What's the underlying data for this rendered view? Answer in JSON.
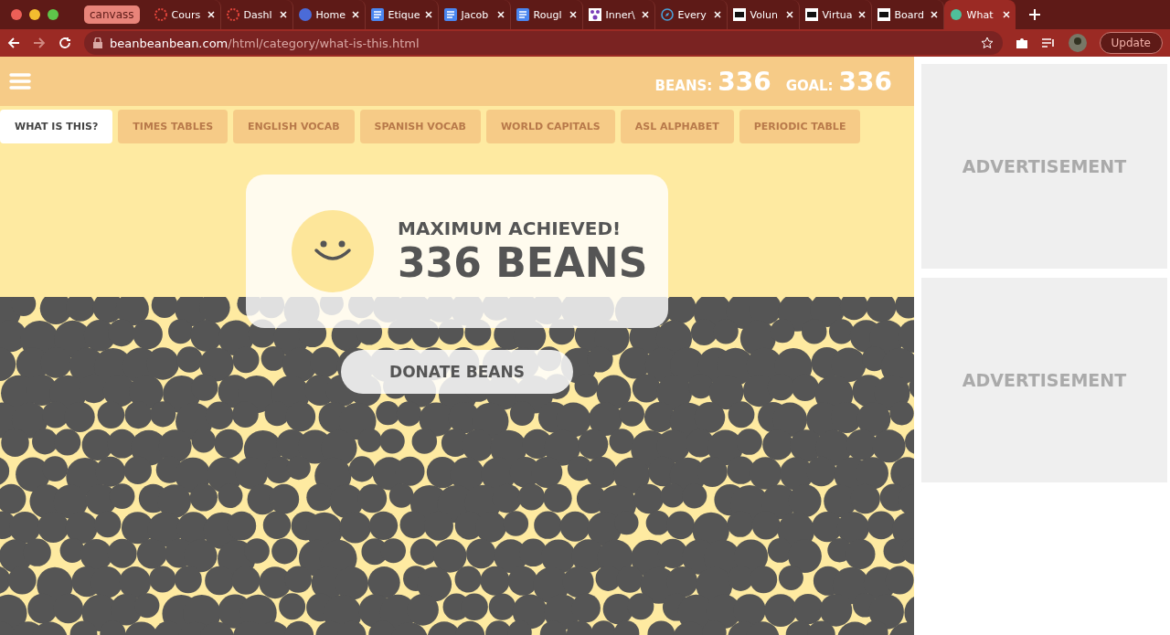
{
  "browser": {
    "tab_group": "canvass",
    "tabs": [
      {
        "title": "Cours",
        "kind": "wheel",
        "selected": false
      },
      {
        "title": "Dashl",
        "kind": "wheel",
        "selected": false
      },
      {
        "title": "Home",
        "kind": "circle",
        "selected": false
      },
      {
        "title": "Etique",
        "kind": "doc",
        "selected": false
      },
      {
        "title": "Jacob",
        "kind": "doc",
        "selected": false
      },
      {
        "title": "Rougl",
        "kind": "doc",
        "selected": false
      },
      {
        "title": "Inner\\",
        "kind": "network",
        "selected": false
      },
      {
        "title": "Every",
        "kind": "compass",
        "selected": false
      },
      {
        "title": "Volun",
        "kind": "square",
        "selected": false
      },
      {
        "title": "Virtua",
        "kind": "square",
        "selected": false
      },
      {
        "title": "Board",
        "kind": "square",
        "selected": false
      },
      {
        "title": "What",
        "kind": "dot",
        "selected": true
      }
    ],
    "url_host": "beanbeanbean.com",
    "url_path": "/html/category/what-is-this.html",
    "update": "Update"
  },
  "header": {
    "beans_label": "BEANS:",
    "beans": "336",
    "goal_label": "GOAL:",
    "goal": "336"
  },
  "categories": [
    {
      "label": "WHAT IS THIS?",
      "selected": true
    },
    {
      "label": "TIMES TABLES",
      "selected": false
    },
    {
      "label": "ENGLISH VOCAB",
      "selected": false
    },
    {
      "label": "SPANISH VOCAB",
      "selected": false
    },
    {
      "label": "WORLD CAPITALS",
      "selected": false
    },
    {
      "label": "ASL ALPHABET",
      "selected": false
    },
    {
      "label": "PERIODIC TABLE",
      "selected": false
    }
  ],
  "result": {
    "title": "MAXIMUM ACHIEVED!",
    "count": "336 BEANS"
  },
  "donate": "DONATE BEANS",
  "ads": [
    "ADVERTISEMENT",
    "ADVERTISEMENT"
  ]
}
